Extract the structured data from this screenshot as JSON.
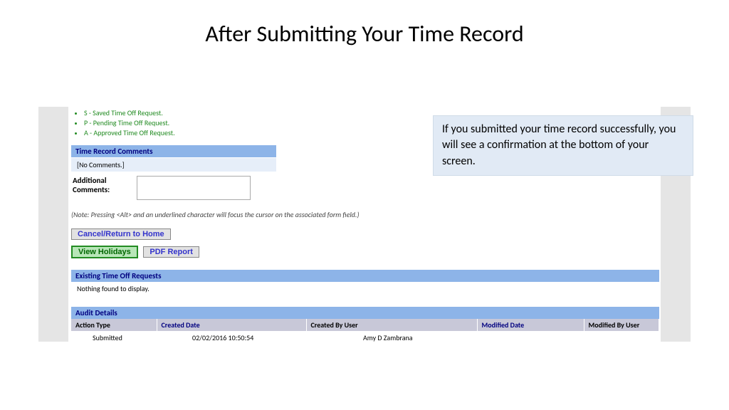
{
  "slide": {
    "title": "After Submitting Your Time Record"
  },
  "legend": {
    "item1": "S - Saved Time Off Request.",
    "item2": "P - Pending Time Off Request.",
    "item3": "A - Approved Time Off Request."
  },
  "comments": {
    "header": "Time Record Comments",
    "none": "[No Comments.]",
    "addl_label": "Additional Comments:",
    "addl_value": ""
  },
  "note": "(Note: Pressing <Alt> and an underlined character will focus the cursor on the associated form field.)",
  "buttons": {
    "cancel": "Cancel/Return to Home",
    "holidays": "View Holidays",
    "pdf": "PDF Report"
  },
  "existing": {
    "header": "Existing Time Off Requests",
    "empty": "Nothing found to display."
  },
  "audit": {
    "header": "Audit Details",
    "cols": {
      "action": "Action Type",
      "created_date": "Created Date",
      "created_by": "Created By User",
      "modified_date": "Modified Date",
      "modified_by": "Modified By User"
    },
    "row": {
      "action": "Submitted",
      "created_date": "02/02/2016 10:50:54",
      "created_by": "Amy D Zambrana",
      "modified_date": "",
      "modified_by": ""
    }
  },
  "callout": {
    "text": "If you submitted your time record successfully, you will see  a confirmation at the bottom of your screen."
  }
}
